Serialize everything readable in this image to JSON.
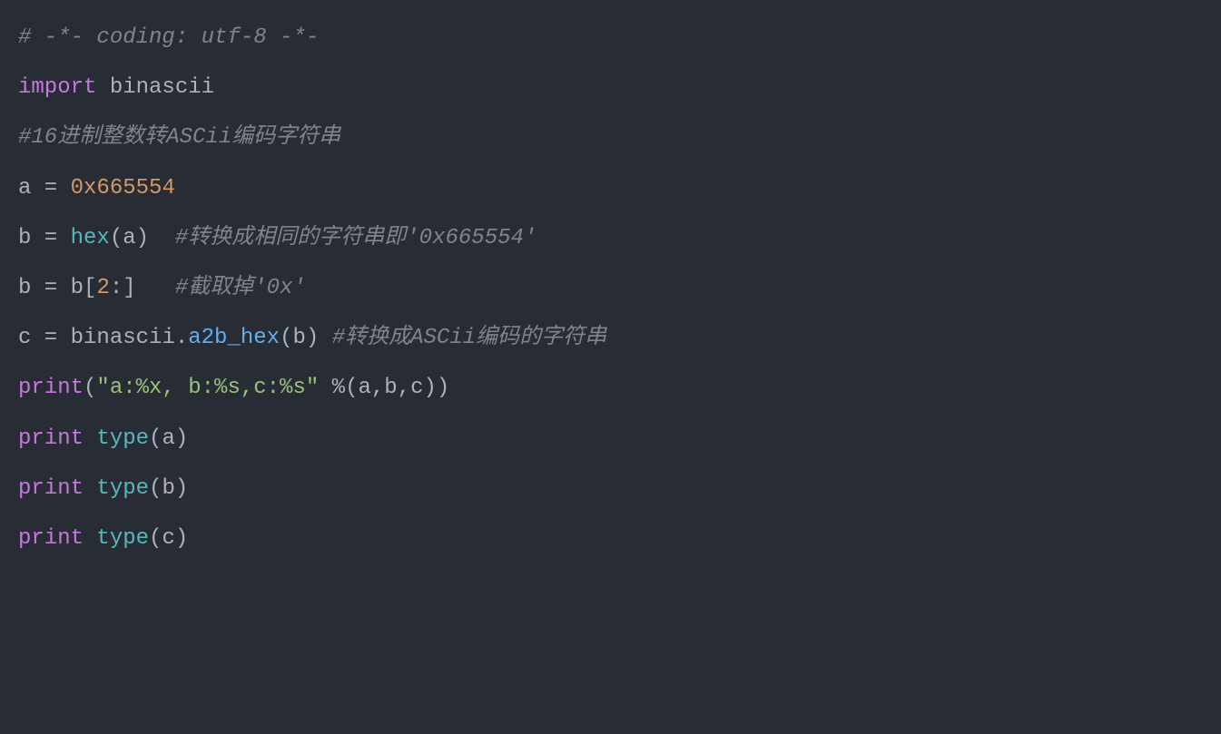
{
  "lines": {
    "l1_comment": "# -*- coding: utf-8 -*-",
    "l2_import": "import",
    "l2_module": " binascii",
    "l3_comment": "#16进制整数转ASCii编码字符串",
    "l4_var": "a",
    "l4_eq": " = ",
    "l4_num": "0x665554",
    "l5_var": "b",
    "l5_eq": " = ",
    "l5_func": "hex",
    "l5_paren_o": "(",
    "l5_arg": "a",
    "l5_paren_c": ")",
    "l5_sp": "  ",
    "l5_comment": "#转换成相同的字符串即'0x665554'",
    "l6_var": "b",
    "l6_eq": " = ",
    "l6_rhs_var": "b",
    "l6_bracket_o": "[",
    "l6_idx": "2",
    "l6_colon": ":",
    "l6_bracket_c": "]",
    "l6_sp": "   ",
    "l6_comment": "#截取掉'0x'",
    "l7_var": "c",
    "l7_eq": " = ",
    "l7_obj": "binascii",
    "l7_dot": ".",
    "l7_func": "a2b_hex",
    "l7_paren_o": "(",
    "l7_arg": "b",
    "l7_paren_c": ")",
    "l7_sp": " ",
    "l7_comment": "#转换成ASCii编码的字符串",
    "l8_print": "print",
    "l8_paren_o": "(",
    "l8_str": "\"a:%x, b:%s,c:%s\"",
    "l8_sp": " ",
    "l8_pct": "%",
    "l8_paren_o2": "(",
    "l8_a": "a",
    "l8_c1": ",",
    "l8_b": "b",
    "l8_c2": ",",
    "l8_cc": "c",
    "l8_paren_c2": ")",
    "l8_paren_c": ")",
    "l9_print": "print",
    "l9_sp": " ",
    "l9_type": "type",
    "l9_paren_o": "(",
    "l9_arg": "a",
    "l9_paren_c": ")",
    "l10_print": "print",
    "l10_sp": " ",
    "l10_type": "type",
    "l10_paren_o": "(",
    "l10_arg": "b",
    "l10_paren_c": ")",
    "l11_print": "print",
    "l11_sp": " ",
    "l11_type": "type",
    "l11_paren_o": "(",
    "l11_arg": "c",
    "l11_paren_c": ")"
  }
}
